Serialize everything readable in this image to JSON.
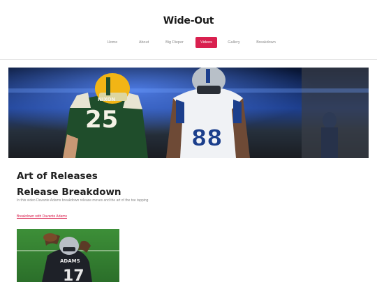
{
  "site": {
    "title": "Wide-Out"
  },
  "nav": {
    "items": [
      {
        "label": "Home",
        "active": false
      },
      {
        "label": "About",
        "active": false
      },
      {
        "label": "Big Dieper",
        "active": false
      },
      {
        "label": "Videos",
        "active": true
      },
      {
        "label": "Gallery",
        "active": false
      },
      {
        "label": "Breakdown",
        "active": false
      }
    ]
  },
  "hero": {
    "green_jersey_number": "25",
    "green_nameplate": "NIXON",
    "white_jersey_number": "88"
  },
  "main": {
    "heading1": "Art of Releases",
    "heading2": "Release Breakdown",
    "description": "In this video Davante Adams breakdown release moves and the art of the toe tapping",
    "link_text": "Breakdown with Davante Adams"
  },
  "thumbnail": {
    "nameplate": "ADAMS",
    "jersey_number": "17"
  },
  "colors": {
    "accent": "#d9204f",
    "title": "#1b1b1b",
    "nav_text": "#8a8a8a"
  }
}
